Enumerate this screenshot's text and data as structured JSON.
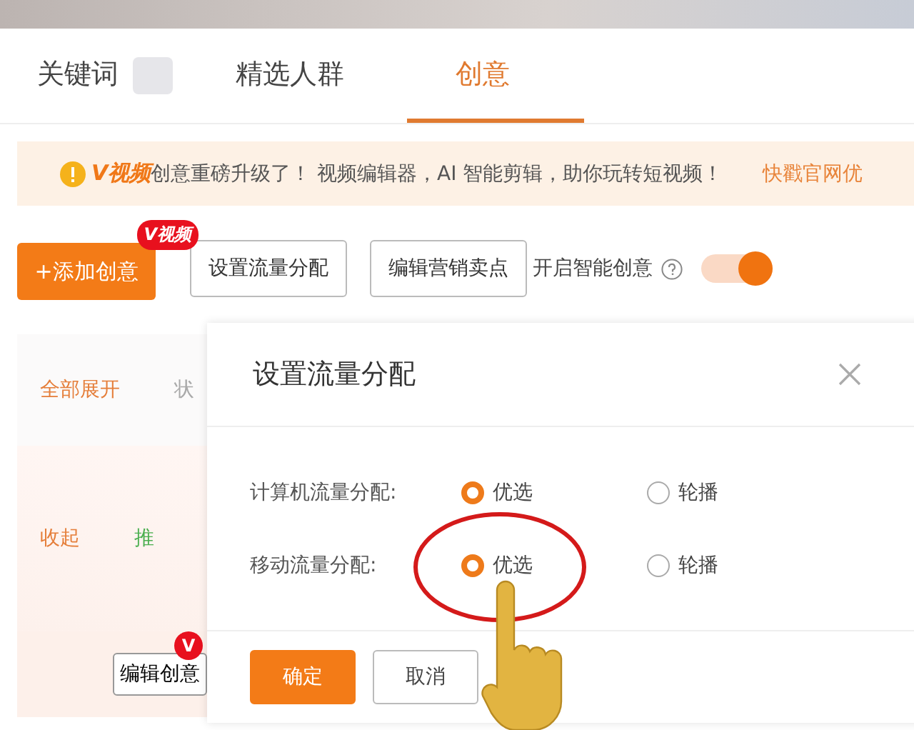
{
  "tabs": [
    {
      "label": "关键词",
      "selected": false,
      "blurred": true
    },
    {
      "label": "精选人群",
      "selected": false,
      "blurred": false
    },
    {
      "label": "创意",
      "selected": true,
      "blurred": false
    }
  ],
  "notice": {
    "brand": "V视频",
    "text": "创意重磅升级了！ 视频编辑器，AI 智能剪辑，助你玩转短视频！",
    "link": "快戳官网优"
  },
  "toolbar": {
    "add_button": "+添加创意",
    "add_badge": "V视频",
    "buttons": [
      "设置流量分配",
      "编辑营销卖点"
    ],
    "smart_label": "开启智能创意",
    "smart_on": true
  },
  "table": {
    "header": [
      "全部展开",
      "状"
    ],
    "row": [
      "收起",
      "推"
    ],
    "footer_button": "编辑创意",
    "footer_badge": "V"
  },
  "dialog": {
    "title": "设置流量分配",
    "rows": [
      {
        "label": "计算机流量分配:",
        "options": [
          {
            "label": "优选",
            "selected": true
          },
          {
            "label": "轮播",
            "selected": false
          }
        ]
      },
      {
        "label": "移动流量分配:",
        "options": [
          {
            "label": "优选",
            "selected": true
          },
          {
            "label": "轮播",
            "selected": false
          }
        ]
      }
    ],
    "buttons": [
      {
        "label": "确定",
        "kind": "primary"
      },
      {
        "label": "取消",
        "kind": "default"
      }
    ]
  }
}
